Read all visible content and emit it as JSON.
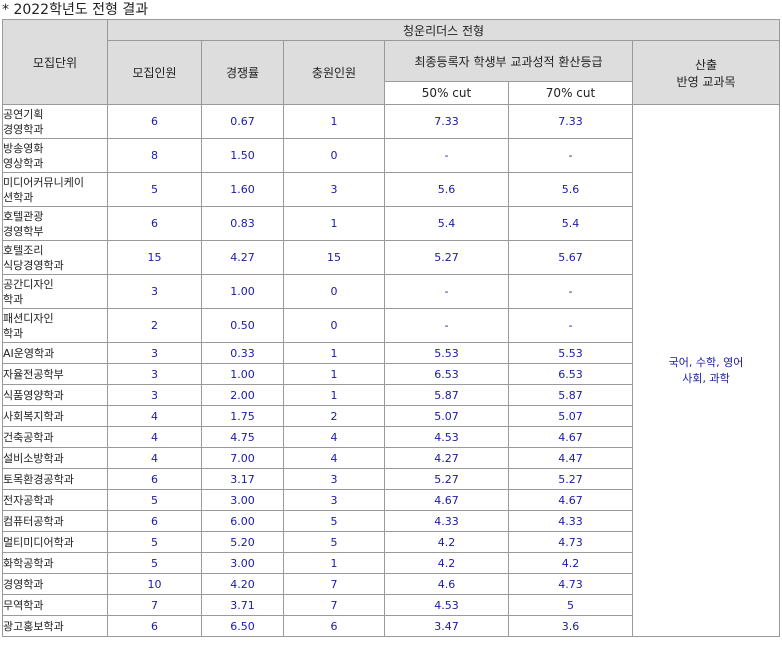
{
  "caption": "* 2022학년도 전형 결과",
  "header": {
    "unit": "모집단위",
    "admission_type": "청운리더스 전형",
    "recruit": "모집인원",
    "competition": "경쟁률",
    "waitlist": "충원인원",
    "grade_group": "최종등록자 학생부 교과성적 환산등급",
    "cut50": "50% cut",
    "cut70": "70% cut",
    "subjects_line1": "산출",
    "subjects_line2": "반영 교과목"
  },
  "subjects": {
    "line1": "국어, 수학, 영어",
    "line2": "사회, 과학"
  },
  "rows": [
    {
      "line1": "공연기획",
      "line2": "경영학과",
      "recruit": "6",
      "competition": "0.67",
      "waitlist": "1",
      "cut50": "7.33",
      "cut70": "7.33"
    },
    {
      "line1": "방송영화",
      "line2": "영상학과",
      "recruit": "8",
      "competition": "1.50",
      "waitlist": "0",
      "cut50": "-",
      "cut70": "-"
    },
    {
      "line1": "미디어커뮤니케이",
      "line2": "션학과",
      "recruit": "5",
      "competition": "1.60",
      "waitlist": "3",
      "cut50": "5.6",
      "cut70": "5.6"
    },
    {
      "line1": "호텔관광",
      "line2": "경영학부",
      "recruit": "6",
      "competition": "0.83",
      "waitlist": "1",
      "cut50": "5.4",
      "cut70": "5.4"
    },
    {
      "line1": "호텔조리",
      "line2": "식당경영학과",
      "recruit": "15",
      "competition": "4.27",
      "waitlist": "15",
      "cut50": "5.27",
      "cut70": "5.67"
    },
    {
      "line1": "공간디자인",
      "line2": "학과",
      "recruit": "3",
      "competition": "1.00",
      "waitlist": "0",
      "cut50": "-",
      "cut70": "-"
    },
    {
      "line1": "패션디자인",
      "line2": "학과",
      "recruit": "2",
      "competition": "0.50",
      "waitlist": "0",
      "cut50": "-",
      "cut70": "-"
    },
    {
      "line1": "AI운영학과",
      "line2": "",
      "recruit": "3",
      "competition": "0.33",
      "waitlist": "1",
      "cut50": "5.53",
      "cut70": "5.53"
    },
    {
      "line1": "자율전공학부",
      "line2": "",
      "recruit": "3",
      "competition": "1.00",
      "waitlist": "1",
      "cut50": "6.53",
      "cut70": "6.53"
    },
    {
      "line1": "식품영양학과",
      "line2": "",
      "recruit": "3",
      "competition": "2.00",
      "waitlist": "1",
      "cut50": "5.87",
      "cut70": "5.87"
    },
    {
      "line1": "사회복지학과",
      "line2": "",
      "recruit": "4",
      "competition": "1.75",
      "waitlist": "2",
      "cut50": "5.07",
      "cut70": "5.07"
    },
    {
      "line1": "건축공학과",
      "line2": "",
      "recruit": "4",
      "competition": "4.75",
      "waitlist": "4",
      "cut50": "4.53",
      "cut70": "4.67"
    },
    {
      "line1": "설비소방학과",
      "line2": "",
      "recruit": "4",
      "competition": "7.00",
      "waitlist": "4",
      "cut50": "4.27",
      "cut70": "4.47"
    },
    {
      "line1": "토목환경공학과",
      "line2": "",
      "recruit": "6",
      "competition": "3.17",
      "waitlist": "3",
      "cut50": "5.27",
      "cut70": "5.27"
    },
    {
      "line1": "전자공학과",
      "line2": "",
      "recruit": "5",
      "competition": "3.00",
      "waitlist": "3",
      "cut50": "4.67",
      "cut70": "4.67"
    },
    {
      "line1": "컴퓨터공학과",
      "line2": "",
      "recruit": "6",
      "competition": "6.00",
      "waitlist": "5",
      "cut50": "4.33",
      "cut70": "4.33"
    },
    {
      "line1": "멀티미디어학과",
      "line2": "",
      "recruit": "5",
      "competition": "5.20",
      "waitlist": "5",
      "cut50": "4.2",
      "cut70": "4.73"
    },
    {
      "line1": "화학공학과",
      "line2": "",
      "recruit": "5",
      "competition": "3.00",
      "waitlist": "1",
      "cut50": "4.2",
      "cut70": "4.2"
    },
    {
      "line1": "경영학과",
      "line2": "",
      "recruit": "10",
      "competition": "4.20",
      "waitlist": "7",
      "cut50": "4.6",
      "cut70": "4.73"
    },
    {
      "line1": "무역학과",
      "line2": "",
      "recruit": "7",
      "competition": "3.71",
      "waitlist": "7",
      "cut50": "4.53",
      "cut70": "5"
    },
    {
      "line1": "광고홍보학과",
      "line2": "",
      "recruit": "6",
      "competition": "6.50",
      "waitlist": "6",
      "cut50": "3.47",
      "cut70": "3.6"
    }
  ]
}
